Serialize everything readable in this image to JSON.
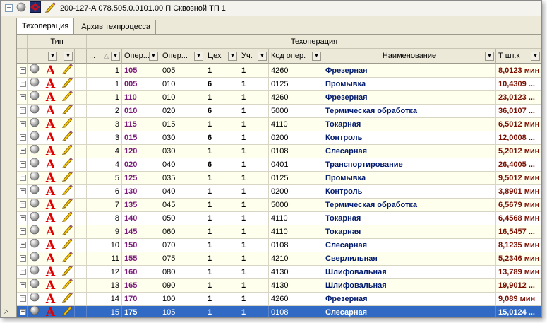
{
  "window": {
    "title": "200-127-А 078.505.0.0101.00 П Сквозной ТП 1",
    "collapse_glyph": "−"
  },
  "tabs": [
    {
      "label": "Техоперация",
      "active": true
    },
    {
      "label": "Архив техпроцесса",
      "active": false
    }
  ],
  "header": {
    "group_type": "Тип",
    "group_techop": "Техоперация",
    "columns": {
      "num": "...",
      "oper": "Опер...",
      "oper2": "Опер...",
      "shop": "Цех",
      "area": "Уч.",
      "code": "Код опер.",
      "name": "Наименование",
      "time": "Т шт.к"
    },
    "dropdown_glyph": "▼",
    "sort_glyph": "△"
  },
  "row_indicator": "▷",
  "expander_glyph": "+",
  "rows": [
    {
      "num": "1",
      "oper": "105",
      "oper2": "005",
      "shop": "1",
      "area": "1",
      "code": "4260",
      "name": "Фрезерная",
      "time": "8,0123 мин"
    },
    {
      "num": "1",
      "oper": "005",
      "oper2": "010",
      "shop": "6",
      "area": "1",
      "code": "0125",
      "name": "Промывка",
      "time": "10,4309 ..."
    },
    {
      "num": "1",
      "oper": "110",
      "oper2": "010",
      "shop": "1",
      "area": "1",
      "code": "4260",
      "name": "Фрезерная",
      "time": "23,0123 ..."
    },
    {
      "num": "2",
      "oper": "010",
      "oper2": "020",
      "shop": "6",
      "area": "1",
      "code": "5000",
      "name": "Термическая обработка",
      "time": "36,0107 ..."
    },
    {
      "num": "3",
      "oper": "115",
      "oper2": "015",
      "shop": "1",
      "area": "1",
      "code": "4110",
      "name": "Токарная",
      "time": "6,5012 мин"
    },
    {
      "num": "3",
      "oper": "015",
      "oper2": "030",
      "shop": "6",
      "area": "1",
      "code": "0200",
      "name": "Контроль",
      "time": "12,0008 ..."
    },
    {
      "num": "4",
      "oper": "120",
      "oper2": "030",
      "shop": "1",
      "area": "1",
      "code": "0108",
      "name": "Слесарная",
      "time": "5,2012 мин"
    },
    {
      "num": "4",
      "oper": "020",
      "oper2": "040",
      "shop": "6",
      "area": "1",
      "code": "0401",
      "name": "Транспортирование",
      "time": "26,4005 ..."
    },
    {
      "num": "5",
      "oper": "125",
      "oper2": "035",
      "shop": "1",
      "area": "1",
      "code": "0125",
      "name": "Промывка",
      "time": "9,5012 мин"
    },
    {
      "num": "6",
      "oper": "130",
      "oper2": "040",
      "shop": "1",
      "area": "1",
      "code": "0200",
      "name": "Контроль",
      "time": "3,8901 мин"
    },
    {
      "num": "7",
      "oper": "135",
      "oper2": "045",
      "shop": "1",
      "area": "1",
      "code": "5000",
      "name": "Термическая обработка",
      "time": "6,5679 мин"
    },
    {
      "num": "8",
      "oper": "140",
      "oper2": "050",
      "shop": "1",
      "area": "1",
      "code": "4110",
      "name": "Токарная",
      "time": "6,4568 мин"
    },
    {
      "num": "9",
      "oper": "145",
      "oper2": "060",
      "shop": "1",
      "area": "1",
      "code": "4110",
      "name": "Токарная",
      "time": "16,5457 ..."
    },
    {
      "num": "10",
      "oper": "150",
      "oper2": "070",
      "shop": "1",
      "area": "1",
      "code": "0108",
      "name": "Слесарная",
      "time": "8,1235 мин"
    },
    {
      "num": "11",
      "oper": "155",
      "oper2": "075",
      "shop": "1",
      "area": "1",
      "code": "4210",
      "name": "Сверлильная",
      "time": "5,2346 мин"
    },
    {
      "num": "12",
      "oper": "160",
      "oper2": "080",
      "shop": "1",
      "area": "1",
      "code": "4130",
      "name": "Шлифовальная",
      "time": "13,789 мин"
    },
    {
      "num": "13",
      "oper": "165",
      "oper2": "090",
      "shop": "1",
      "area": "1",
      "code": "4130",
      "name": "Шлифовальная",
      "time": "19,9012 ..."
    },
    {
      "num": "14",
      "oper": "170",
      "oper2": "100",
      "shop": "1",
      "area": "1",
      "code": "4260",
      "name": "Фрезерная",
      "time": "9,089 мин"
    },
    {
      "num": "15",
      "oper": "175",
      "oper2": "105",
      "shop": "1",
      "area": "1",
      "code": "0108",
      "name": "Слесарная",
      "time": "15,0124 ...",
      "selected": true
    }
  ],
  "colors": {
    "selection": "#316ac5",
    "row_alt": "#ffffee",
    "oper_text": "#7b1a7a",
    "name_text": "#001a6e",
    "time_text": "#7a0e00",
    "type_icon_a": "#e00000"
  },
  "icons": [
    "sphere-icon",
    "gear-badge-icon",
    "pencil-icon",
    "letter-a-icon"
  ]
}
